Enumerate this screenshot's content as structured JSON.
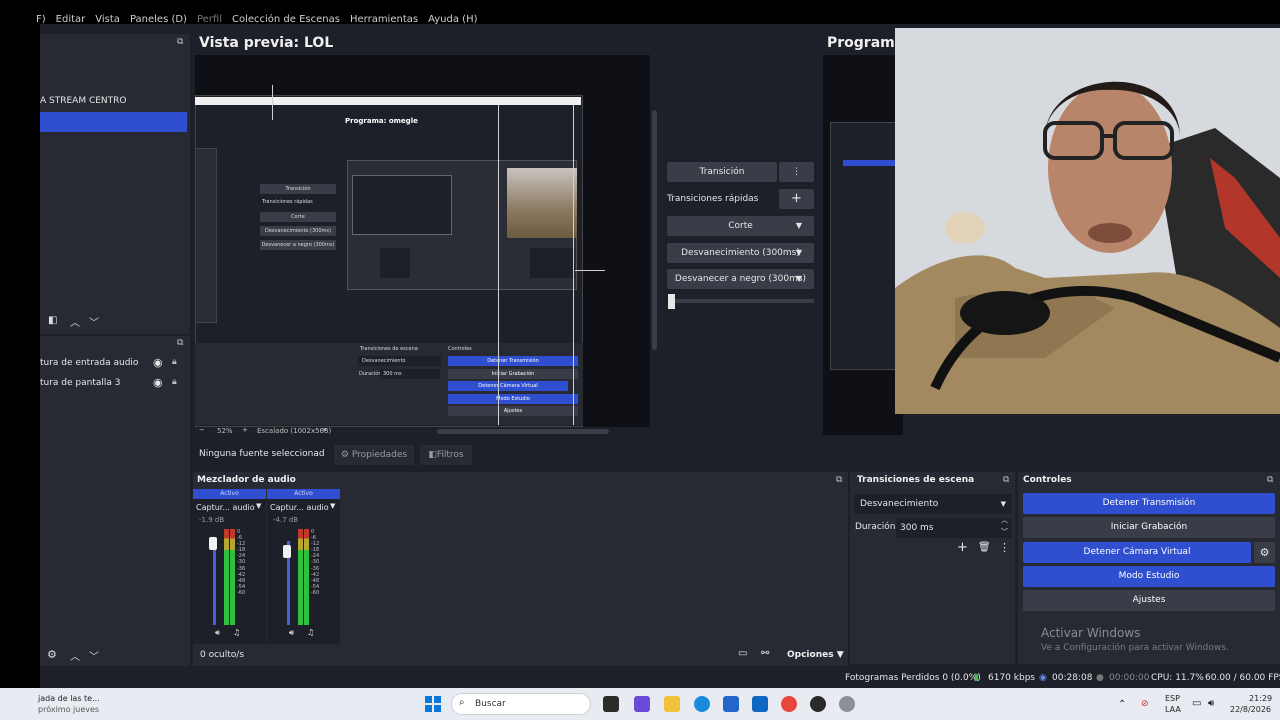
{
  "menu": {
    "items": [
      "F)",
      "Editar",
      "Vista",
      "Paneles (D)",
      "Perfil",
      "Colección de Escenas",
      "Herramientas",
      "Ayuda (H)"
    ]
  },
  "scenes": {
    "items": [
      "A STREAM CENTRO",
      ""
    ],
    "selected_index": 1
  },
  "sources": {
    "items": [
      {
        "label": "tura de entrada audio"
      },
      {
        "label": "tura de pantalla 3"
      }
    ]
  },
  "preview": {
    "title": "Vista previa: LOL",
    "zoom": "52%",
    "scaled": "Escalado (1002x563)",
    "minus": "−",
    "plus": "+"
  },
  "inner": {
    "program_title": "Programa: omegle",
    "transicion": "Transición",
    "rapidas": "Transiciones rápidas",
    "corte": "Corte",
    "desv": "Desvanecimiento (300ms)",
    "negro": "Desvanecer a negro (300ms)",
    "st_head": "Transiciones de escena",
    "st_select": "Desvanecimiento",
    "st_dur_label": "Duración",
    "st_dur": "300 ms",
    "ctrl_head": "Controles",
    "ctrl_buttons": [
      "Detener Transmisión",
      "Iniciar Grabación",
      "Detener Cámara Virtual",
      "Modo Estudio",
      "Ajustes"
    ]
  },
  "transition": {
    "transicion": "Transición",
    "rapidas": "Transiciones rápidas",
    "corte": "Corte",
    "desv": "Desvanecimiento (300ms)",
    "negro": "Desvanecer a negro (300ms)"
  },
  "program": {
    "title": "Programa:"
  },
  "source_toolbar": {
    "no_source": "Ninguna fuente seleccionad",
    "properties": "Propiedades",
    "filters": "Filtros"
  },
  "mixer": {
    "title": "Mezclador de audio",
    "channels": [
      {
        "tag": "Activo",
        "name": "Captur... audio",
        "db": "-1.9 dB",
        "level": 0.88
      },
      {
        "tag": "Activo",
        "name": "Captur... audio",
        "db": "-4.7 dB",
        "level": 0.78
      }
    ],
    "scale": "0\n-6\n-12\n-18\n-24\n-30\n-36\n-42\n-48\n-54\n-60",
    "hidden": "0 oculto/s",
    "options": "Opciones"
  },
  "scene_transitions": {
    "title": "Transiciones de escena",
    "selected": "Desvanecimiento",
    "duration_label": "Duración",
    "duration": "300 ms"
  },
  "controls": {
    "title": "Controles",
    "stop_stream": "Detener Transmisión",
    "start_rec": "Iniciar Grabación",
    "stop_vcam": "Detener Cámara Virtual",
    "studio": "Modo Estudio",
    "settings": "Ajustes"
  },
  "watermark": {
    "line1": "Activar Windows",
    "line2": "Ve a Configuración para activar Windows."
  },
  "status": {
    "dropped": "Fotogramas Perdidos 0 (0.0%)",
    "bitrate": "6170 kbps",
    "stream_time": "00:28:08",
    "rec_time": "00:00:00",
    "cpu": "CPU: 11.7%",
    "fps": "60.00 / 60.00 FPS"
  },
  "taskbar": {
    "weather1": "jada de las te...",
    "weather2": "próximo jueves",
    "search": "Buscar",
    "lang1": "ESP",
    "lang2": "LAA",
    "time": "21:29",
    "date": "22/8/2026"
  },
  "colors": {
    "accent": "#2f4fd0",
    "panel": "#272a33",
    "background": "#1e2029"
  }
}
